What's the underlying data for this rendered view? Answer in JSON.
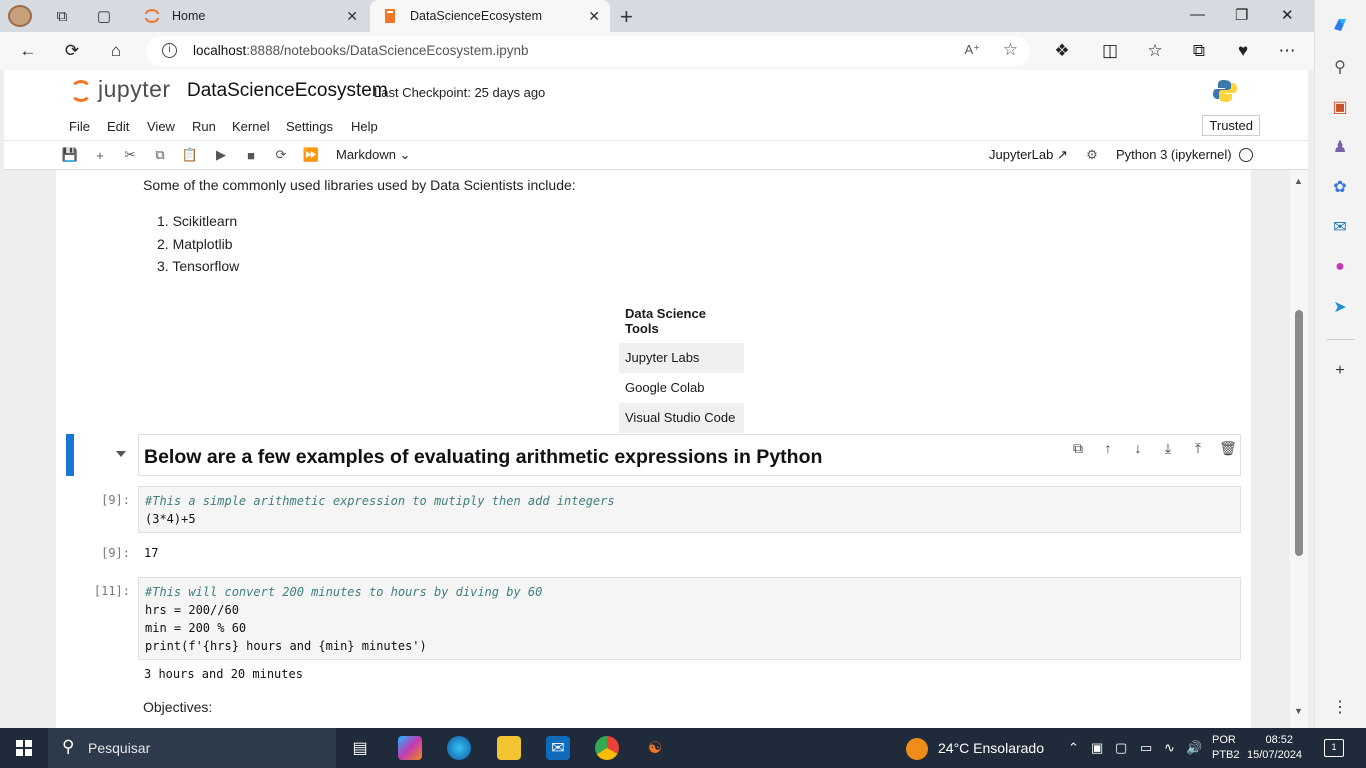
{
  "browser": {
    "tabs": [
      {
        "label": "Home"
      },
      {
        "label": "DataScienceEcosystem"
      }
    ],
    "url": {
      "host": "localhost",
      "path": ":8888/notebooks/DataScienceEcosystem.ipynb"
    }
  },
  "jupyter": {
    "logo_text": "jupyter",
    "notebook_title": "DataScienceEcosystem",
    "checkpoint": "Last Checkpoint: 25 days ago",
    "menu": [
      "File",
      "Edit",
      "View",
      "Run",
      "Kernel",
      "Settings",
      "Help"
    ],
    "trusted": "Trusted",
    "cell_type": "Markdown",
    "jupyterlab_link": "JupyterLab",
    "kernel": "Python 3 (ipykernel)"
  },
  "notebook": {
    "libraries_intro": "Some of the commonly used libraries used by Data Scientists include:",
    "libraries": [
      "1. Scikitlearn",
      "2. Matplotlib",
      "3. Tensorflow"
    ],
    "tools_table": {
      "header": "Data Science Tools",
      "rows": [
        "Jupyter Labs",
        "Google Colab",
        "Visual Studio Code"
      ]
    },
    "heading": "Below are a few examples of evaluating arithmetic expressions in Python",
    "cells": [
      {
        "prompt": "[9]:",
        "lines": [
          "#This a simple arithmetic expression to mutiply then add integers",
          "(3*4)+5"
        ],
        "out_prompt": "[9]:",
        "output": "17"
      },
      {
        "prompt": "[11]:",
        "lines": [
          "#This will convert 200 minutes to hours by diving by 60",
          "hrs = 200//60",
          "min = 200 % 60",
          "print(f'{hrs} hours and {min} minutes')"
        ],
        "output": "3 hours and 20 minutes"
      }
    ],
    "objectives": "Objectives:"
  },
  "taskbar": {
    "search_placeholder": "Pesquisar",
    "weather": "24°C  Ensolarado",
    "lang_line1": "POR",
    "lang_line2": "PTB2",
    "time": "08:52",
    "date": "15/07/2024",
    "notifications": "1"
  }
}
